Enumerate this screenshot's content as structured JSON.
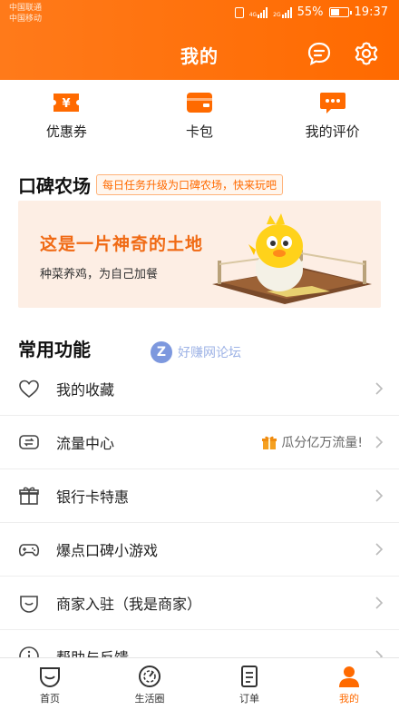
{
  "status_bar": {
    "carrier_1": "中国联通",
    "carrier_2": "中国移动",
    "net_1": "4G",
    "net_2": "2G",
    "battery_text": "55%",
    "battery_level": 0.55,
    "time": "19:37"
  },
  "header": {
    "title": "我的",
    "left_icon": "message-icon",
    "right_icon": "gear-icon"
  },
  "quick_actions": [
    {
      "label": "优惠券",
      "icon": "coupon-icon"
    },
    {
      "label": "卡包",
      "icon": "wallet-icon"
    },
    {
      "label": "我的评价",
      "icon": "review-icon"
    }
  ],
  "farm": {
    "title": "口碑农场",
    "tag": "每日任务升级为口碑农场，快来玩吧",
    "banner_title": "这是一片神奇的土地",
    "banner_subtitle": "种菜养鸡，为自己加餐"
  },
  "watermark": {
    "logo": "Z",
    "text": "好赚网论坛"
  },
  "common": {
    "title": "常用功能",
    "items": [
      {
        "label": "我的收藏",
        "icon": "heart-icon",
        "extra": ""
      },
      {
        "label": "流量中心",
        "icon": "data-exchange-icon",
        "extra": "瓜分亿万流量!"
      },
      {
        "label": "银行卡特惠",
        "icon": "gift-box-icon",
        "extra": ""
      },
      {
        "label": "爆点口碑小游戏",
        "icon": "gamepad-icon",
        "extra": ""
      },
      {
        "label": "商家入驻（我是商家）",
        "icon": "shop-smile-icon",
        "extra": ""
      },
      {
        "label": "帮助与反馈",
        "icon": "info-icon",
        "extra": ""
      }
    ]
  },
  "tabbar": [
    {
      "label": "首页",
      "icon": "home-smile-icon",
      "active": false
    },
    {
      "label": "生活圈",
      "icon": "compass-icon",
      "active": false
    },
    {
      "label": "订单",
      "icon": "order-icon",
      "active": false
    },
    {
      "label": "我的",
      "icon": "person-icon",
      "active": true
    }
  ],
  "colors": {
    "brand_orange": "#ff6a00",
    "banner_bg": "#fdeee4"
  }
}
